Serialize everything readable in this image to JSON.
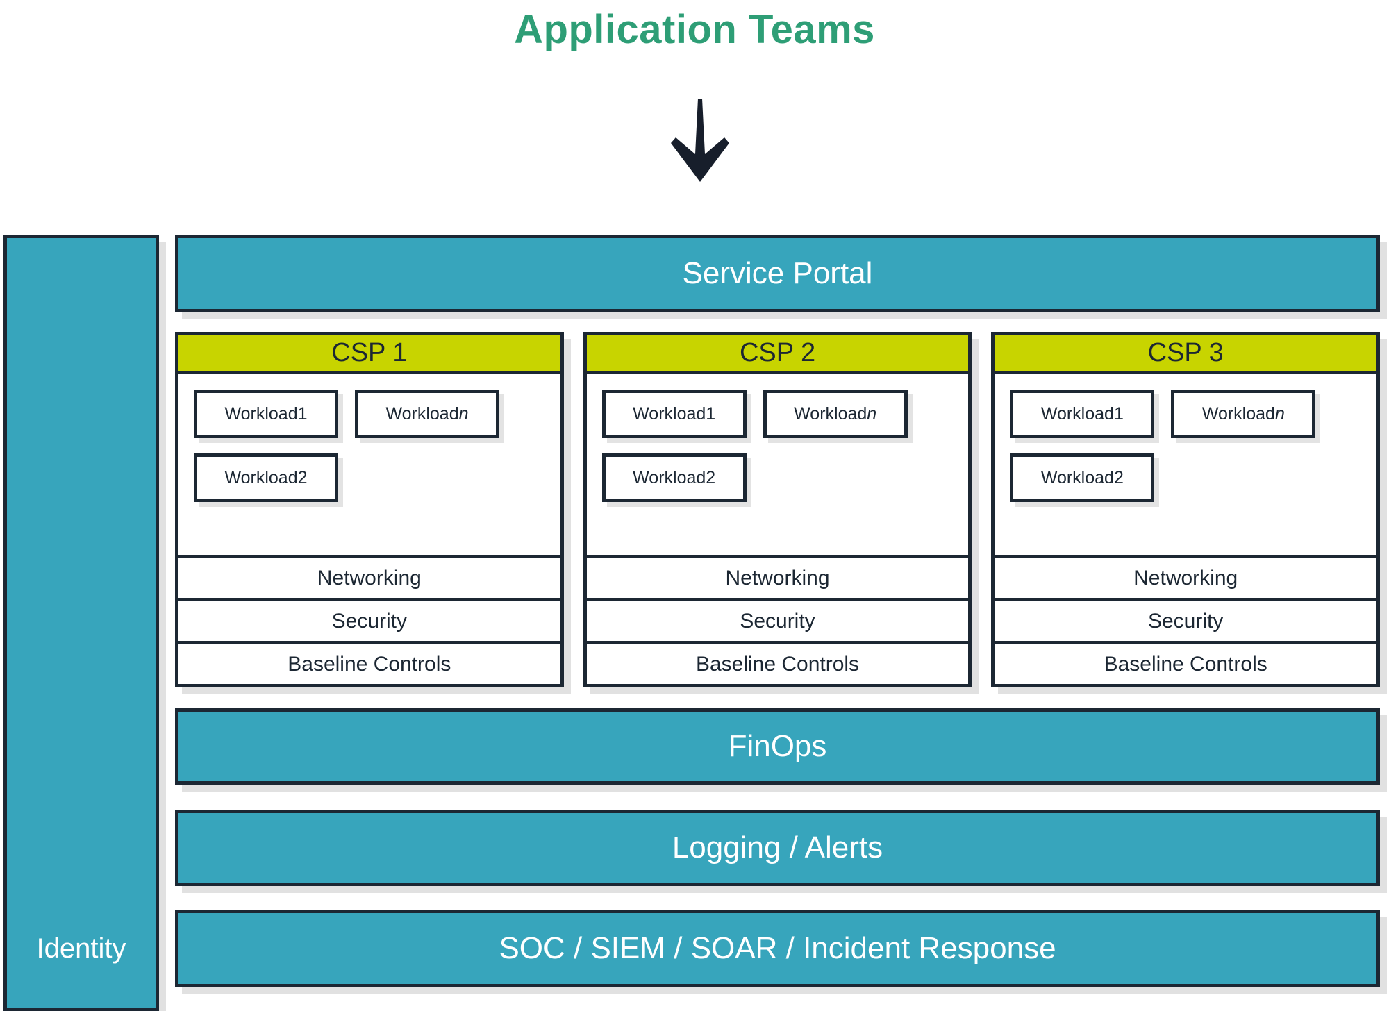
{
  "colors": {
    "title_green": "#2E9E76",
    "teal": "#37A5BC",
    "csp_header_green": "#C8D400",
    "border_navy": "#1C2733",
    "shadow_gray": "#C8C8C8",
    "white": "#FFFFFF"
  },
  "header": {
    "title": "Application Teams",
    "arrow_icon": "down-arrow-icon"
  },
  "sidebar": {
    "label": "Identity"
  },
  "bars": {
    "service_portal": "Service Portal",
    "finops": "FinOps",
    "logging_alerts": "Logging / Alerts",
    "soc": "SOC / SIEM / SOAR / Incident Response"
  },
  "csps": [
    {
      "name": "CSP 1",
      "workloads_row1": [
        {
          "prefix": "Workload ",
          "suffix": "1",
          "italic_suffix": false
        },
        {
          "prefix": "Workload ",
          "suffix": "n",
          "italic_suffix": true
        }
      ],
      "workloads_row2": [
        {
          "prefix": "Workload ",
          "suffix": "2",
          "italic_suffix": false
        }
      ],
      "services": [
        "Networking",
        "Security",
        "Baseline Controls"
      ]
    },
    {
      "name": "CSP 2",
      "workloads_row1": [
        {
          "prefix": "Workload ",
          "suffix": "1",
          "italic_suffix": false
        },
        {
          "prefix": "Workload ",
          "suffix": "n",
          "italic_suffix": true
        }
      ],
      "workloads_row2": [
        {
          "prefix": "Workload ",
          "suffix": "2",
          "italic_suffix": false
        }
      ],
      "services": [
        "Networking",
        "Security",
        "Baseline Controls"
      ]
    },
    {
      "name": "CSP 3",
      "workloads_row1": [
        {
          "prefix": "Workload ",
          "suffix": "1",
          "italic_suffix": false
        },
        {
          "prefix": "Workload ",
          "suffix": "n",
          "italic_suffix": true
        }
      ],
      "workloads_row2": [
        {
          "prefix": "Workload ",
          "suffix": "2",
          "italic_suffix": false
        }
      ],
      "services": [
        "Networking",
        "Security",
        "Baseline Controls"
      ]
    }
  ]
}
